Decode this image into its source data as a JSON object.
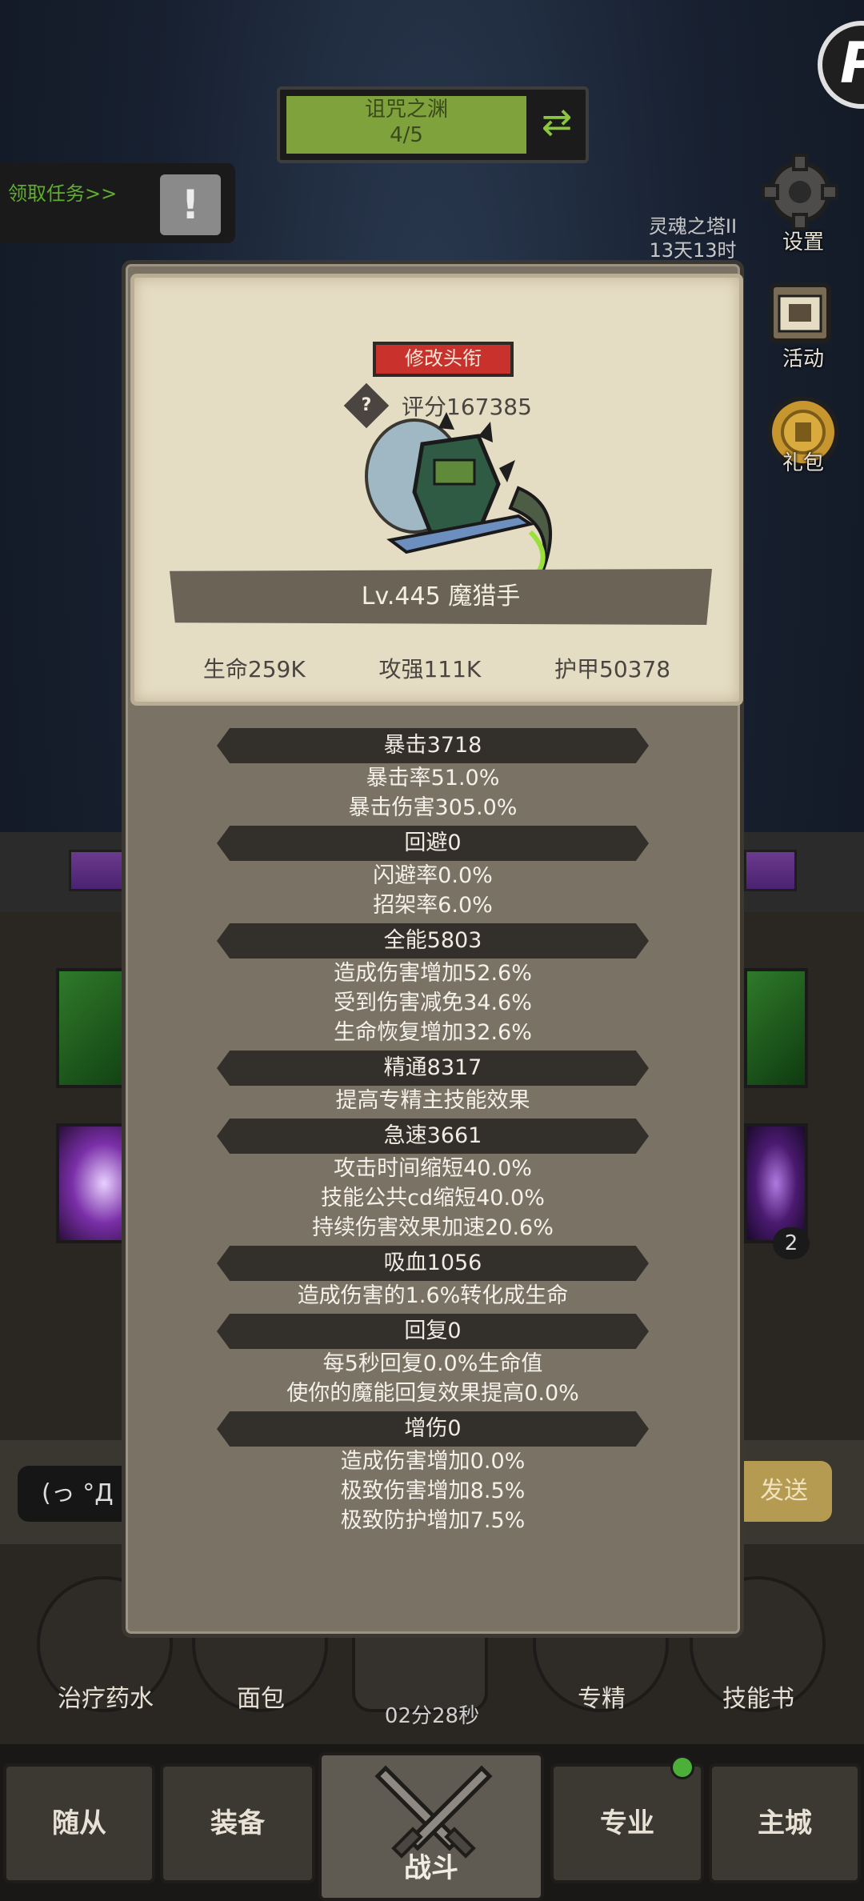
{
  "hud": {
    "stage": {
      "title": "诅咒之渊",
      "progress": "4/5"
    },
    "task": {
      "label": "领取任务>>",
      "alert": "!"
    },
    "tower": {
      "line1": "灵魂之塔II",
      "line2": "13天13时"
    },
    "side_menu": [
      {
        "id": "settings",
        "label": "设置",
        "icon": "gear-icon"
      },
      {
        "id": "events",
        "label": "活动",
        "icon": "calendar-icon"
      },
      {
        "id": "gift",
        "label": "礼包",
        "icon": "gift-icon"
      }
    ]
  },
  "popup": {
    "rename_label": "修改头衔",
    "help_icon": "?",
    "score_label": "评分167385",
    "hero_name": "Lv.445 魔猎手",
    "stats": [
      "生命259K",
      "攻强111K",
      "护甲50378"
    ],
    "attributes": [
      {
        "header": "暴击3718",
        "lines": [
          "暴击率51.0%",
          "暴击伤害305.0%"
        ]
      },
      {
        "header": "回避0",
        "lines": [
          "闪避率0.0%",
          "招架率6.0%"
        ]
      },
      {
        "header": "全能5803",
        "lines": [
          "造成伤害增加52.6%",
          "受到伤害减免34.6%",
          "生命恢复增加32.6%"
        ]
      },
      {
        "header": "精通8317",
        "lines": [
          "提高专精主技能效果"
        ]
      },
      {
        "header": "急速3661",
        "lines": [
          "攻击时间缩短40.0%",
          "技能公共cd缩短40.0%",
          "持续伤害效果加速20.6%"
        ]
      },
      {
        "header": "吸血1056",
        "lines": [
          "造成伤害的1.6%转化成生命"
        ]
      },
      {
        "header": "回复0",
        "lines": [
          "每5秒回复0.0%生命值",
          "使你的魔能回复效果提高0.0%"
        ]
      },
      {
        "header": "增伤0",
        "lines": [
          "造成伤害增加0.0%",
          "极致伤害增加8.5%",
          "极致防护增加7.5%"
        ]
      }
    ]
  },
  "chat": {
    "input_text": "(っ °Д °",
    "send_label": "发送"
  },
  "quick_bar": {
    "items": [
      {
        "label": "治疗药水"
      },
      {
        "label": "面包"
      },
      {
        "label": "专精"
      },
      {
        "label": "技能书"
      }
    ],
    "timer": "02分28秒",
    "badge": "2"
  },
  "bottom_nav": {
    "tabs": [
      {
        "label": "随从"
      },
      {
        "label": "装备"
      },
      {
        "label": "战斗"
      },
      {
        "label": "专业"
      },
      {
        "label": "主城"
      }
    ]
  }
}
